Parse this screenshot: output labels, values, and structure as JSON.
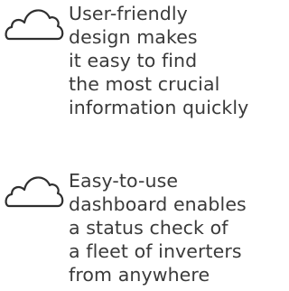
{
  "features": [
    {
      "icon": "cloud-icon",
      "lines": [
        "User-friendly",
        "design makes",
        "it easy to find",
        "the most crucial",
        "information quickly"
      ]
    },
    {
      "icon": "cloud-icon",
      "lines": [
        "Easy-to-use",
        "dashboard enables",
        "a status check of",
        "a fleet of inverters",
        "from anywhere"
      ]
    }
  ],
  "colors": {
    "text": "#3a3a3a",
    "icon_stroke": "#2f2f2f",
    "background": "#ffffff"
  }
}
